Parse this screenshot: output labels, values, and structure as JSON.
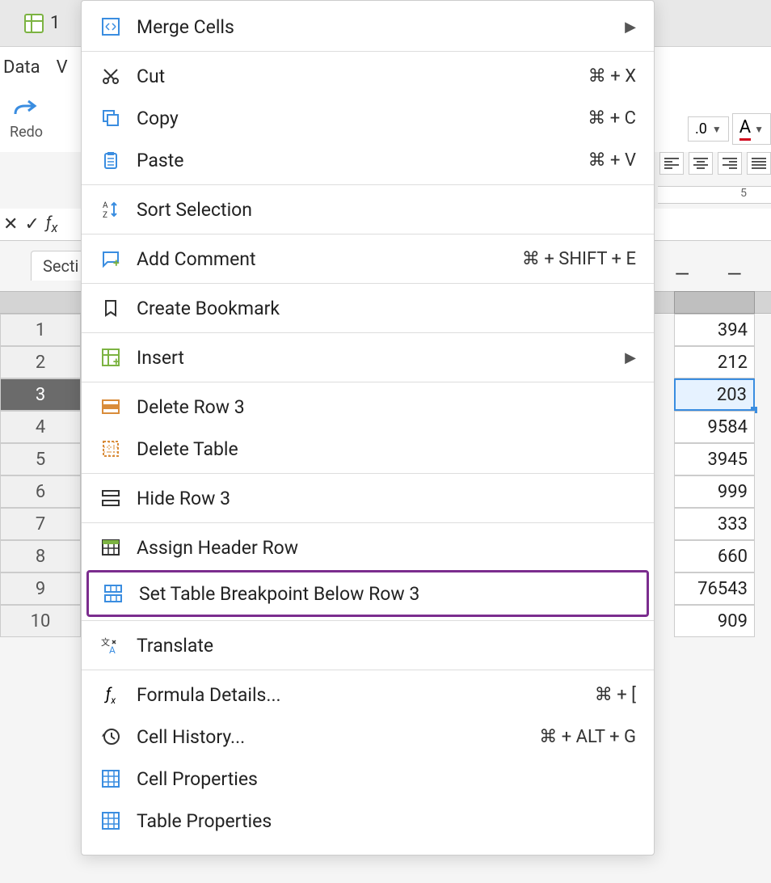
{
  "tabs": {
    "first_label": "1"
  },
  "menubar": {
    "data": "Data",
    "view_partial": "V"
  },
  "toolbar": {
    "redo_label": "Redo",
    "decimal_value": ".0",
    "font_color_letter": "A"
  },
  "ruler": {
    "tick5": "5"
  },
  "section_tab": "Secti",
  "dashes": "— — —",
  "sheet": {
    "rows": [
      {
        "num": "1",
        "value": "394"
      },
      {
        "num": "2",
        "value": "212"
      },
      {
        "num": "3",
        "value": "203",
        "selected": true
      },
      {
        "num": "4",
        "value": "9584"
      },
      {
        "num": "5",
        "value": "3945"
      },
      {
        "num": "6",
        "value": "999"
      },
      {
        "num": "7",
        "value": "333"
      },
      {
        "num": "8",
        "value": "660"
      },
      {
        "num": "9",
        "value": "76543"
      },
      {
        "num": "10",
        "value": "909"
      }
    ]
  },
  "context_menu": {
    "merge_cells": "Merge Cells",
    "cut": "Cut",
    "cut_shortcut": "⌘ + X",
    "copy": "Copy",
    "copy_shortcut": "⌘ + C",
    "paste": "Paste",
    "paste_shortcut": "⌘ + V",
    "sort_selection": "Sort Selection",
    "add_comment": "Add Comment",
    "add_comment_shortcut": "⌘ + SHIFT + E",
    "create_bookmark": "Create Bookmark",
    "insert": "Insert",
    "delete_row": "Delete Row 3",
    "delete_table": "Delete Table",
    "hide_row": "Hide Row 3",
    "assign_header_row": "Assign Header Row",
    "set_breakpoint": "Set Table Breakpoint Below Row 3",
    "translate": "Translate",
    "formula_details": "Formula Details...",
    "formula_details_shortcut": "⌘ + [",
    "cell_history": "Cell History...",
    "cell_history_shortcut": "⌘ + ALT + G",
    "cell_properties": "Cell Properties",
    "table_properties": "Table Properties"
  }
}
